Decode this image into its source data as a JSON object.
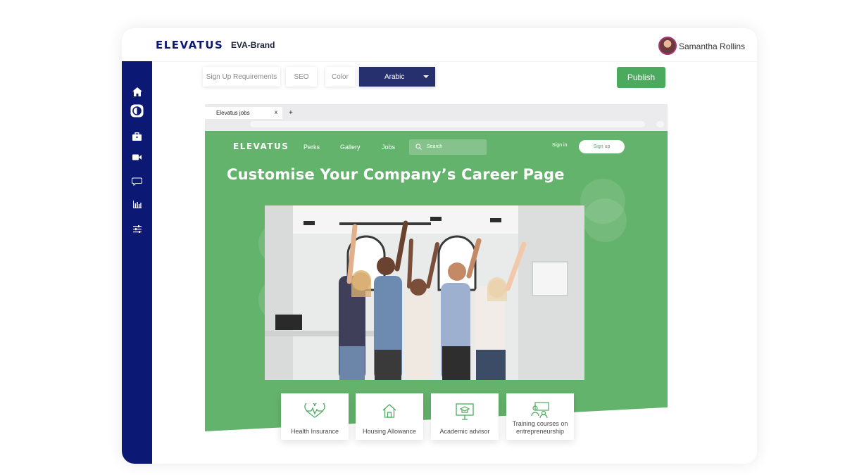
{
  "app": {
    "logo": "ELEVATUS",
    "brand": "EVA-Brand",
    "user_name": "Samantha Rollins"
  },
  "toolbar": {
    "tabs": [
      "Sign  Up Requirements",
      "SEO",
      "Color"
    ],
    "language": "Arabic",
    "publish_label": "Publish"
  },
  "sidebar": {
    "icons": [
      "home-icon",
      "theme-icon",
      "briefcase-icon",
      "video-icon",
      "chat-icon",
      "analytics-icon",
      "settings-sliders-icon"
    ]
  },
  "browser": {
    "tab_title": "Elevatus jobs",
    "tab_close": "x",
    "new_tab": "+"
  },
  "career_page": {
    "logo": "ELEVATUS",
    "nav": [
      "Perks",
      "Gallery",
      "Jobs"
    ],
    "search_placeholder": "Search",
    "sign_in": "Sign in",
    "sign_up": "Sign up",
    "headline": "Customise Your Company’s Career Page",
    "perks": [
      {
        "label": "Health Insurance",
        "icon": "heartbeat-icon"
      },
      {
        "label": "Housing Allowance",
        "icon": "house-icon"
      },
      {
        "label": "Academic advisor",
        "icon": "graduation-monitor-icon"
      },
      {
        "label": "Training courses on entrepreneurship",
        "icon": "training-icon"
      }
    ]
  },
  "colors": {
    "sidebar": "#0b1874",
    "accent_green": "#4caa5e",
    "site_green": "#64b36c",
    "language_select": "#26306e"
  }
}
